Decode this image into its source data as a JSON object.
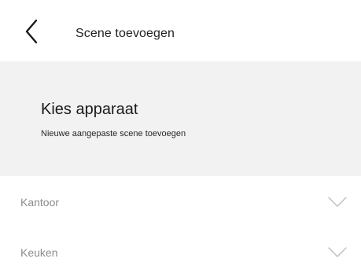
{
  "header": {
    "back_icon": "chevron-left-icon",
    "title": "Scene toevoegen"
  },
  "banner": {
    "title": "Kies apparaat",
    "subtitle": "Nieuwe aangepaste scene toevoegen",
    "background": "#f2f2f2"
  },
  "rooms": [
    {
      "label": "Kantoor",
      "icon": "chevron-down-icon",
      "expanded": false
    },
    {
      "label": "Keuken",
      "icon": "chevron-down-icon",
      "expanded": false
    }
  ],
  "colors": {
    "text_primary": "#1a1a1a",
    "text_muted": "#8c8c8c",
    "icon_muted": "#bdbdbd"
  }
}
